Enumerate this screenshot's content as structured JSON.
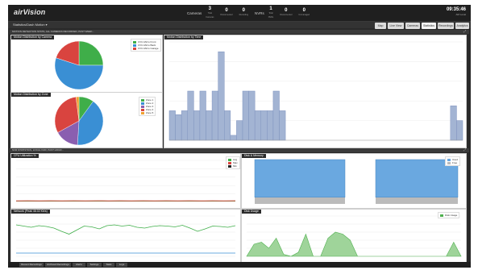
{
  "app": {
    "logo": "airVision"
  },
  "header": {
    "cameras_label": "Cameras",
    "nvrs_label": "NVRs",
    "stats": [
      {
        "value": "3",
        "label": "Total Cameras"
      },
      {
        "value": "0",
        "label": "Disconnected"
      },
      {
        "value": "0",
        "label": "Recording"
      },
      {
        "value": "1",
        "label": "Total NVRs"
      },
      {
        "value": "0",
        "label": "Disconnected"
      },
      {
        "value": "0",
        "label": "Unmanaged"
      }
    ],
    "clock_time": "09:35:46",
    "clock_sub": "AM Local"
  },
  "workspace": {
    "label": "Statistics/Dash Motion ▾"
  },
  "tabs": [
    {
      "label": "Map"
    },
    {
      "label": "Live View"
    },
    {
      "label": "Cameras"
    },
    {
      "label": "Statistics"
    },
    {
      "label": "Recordings"
    },
    {
      "label": "Analytics"
    }
  ],
  "section1": {
    "header": "MOTION DETECTION STATS, ALL CAMERAS RECORDED, PAST WEEK..."
  },
  "section2": {
    "header": "NVR STATISTICS, LOCAL NVR, PAST HOUR..."
  },
  "panels": {
    "motion_camera": "Motion Distribution by Camera",
    "motion_time": "Motion Distribution by Time",
    "motion_zone": "Motion Distribution by Zone",
    "cpu": "CPU Utilization %",
    "disk_memory": "Disk & Memory",
    "network": "Network (Peak 46.02 Kb/s)",
    "disk_usage": "Disk Usage"
  },
  "legends": {
    "camera": [
      {
        "name": "UVC-Micro Front",
        "color": "#3fae49"
      },
      {
        "name": "UVC-Micro Back",
        "color": "#3a8fd4"
      },
      {
        "name": "UVC-Micro Garage",
        "color": "#d9443f"
      }
    ],
    "zone": [
      {
        "name": "Zone 1",
        "color": "#3fae49"
      },
      {
        "name": "Zone 2",
        "color": "#3a8fd4"
      },
      {
        "name": "Zone 3",
        "color": "#8a5fb0"
      },
      {
        "name": "Zone 4",
        "color": "#d9443f"
      },
      {
        "name": "Zone 5",
        "color": "#f0a030"
      }
    ],
    "cpu": [
      {
        "name": "Avg",
        "color": "#3fae49"
      },
      {
        "name": "Max",
        "color": "#d9443f"
      },
      {
        "name": "Min",
        "color": "#222222"
      }
    ],
    "disk": [
      {
        "name": "Used",
        "color": "#6aa8e0"
      },
      {
        "name": "Free",
        "color": "#bbbbbb"
      }
    ],
    "disk_usage": [
      {
        "name": "Disk Usage",
        "color": "#4fb04f"
      }
    ]
  },
  "bottom_tabs": [
    {
      "label": "Recent Recordings"
    },
    {
      "label": "Archived Recordings"
    },
    {
      "label": "Alerts"
    },
    {
      "label": "Settings"
    },
    {
      "label": "Stats"
    },
    {
      "label": "Logs"
    }
  ],
  "chart_data": [
    {
      "type": "pie",
      "categories": [
        "UVC-Micro Front",
        "UVC-Micro Back",
        "UVC-Micro Garage"
      ],
      "values": [
        25,
        55,
        20
      ]
    },
    {
      "type": "pie",
      "categories": [
        "Zone 1",
        "Zone 2",
        "Zone 3",
        "Zone 4",
        "Zone 5"
      ],
      "values": [
        10,
        41,
        16,
        31,
        2
      ]
    },
    {
      "type": "bar",
      "values": [
        3,
        2.6,
        3,
        5,
        3,
        5,
        3,
        5,
        9,
        3,
        0.5,
        2,
        5,
        5,
        3,
        3,
        3,
        5,
        3,
        0,
        0,
        0,
        0,
        0,
        0,
        0,
        0,
        0,
        0,
        0,
        0,
        0,
        0,
        0,
        0,
        0,
        0,
        0,
        0,
        0,
        0,
        0,
        0,
        0,
        0,
        0,
        3.5,
        2
      ]
    },
    {
      "type": "line",
      "series": [
        {
          "name": "Avg",
          "values": [
            3,
            3,
            3,
            3,
            3,
            3,
            3,
            3,
            3,
            3,
            3,
            3,
            3,
            3,
            3,
            3,
            3,
            3,
            3,
            3
          ]
        },
        {
          "name": "Max",
          "values": [
            3.4,
            3.5,
            3.3,
            3.6,
            3.4,
            3.5,
            3.3,
            3.6,
            3.4,
            3.5,
            3.3,
            3.6,
            3.4,
            3.5,
            3.3,
            3.6,
            3.4,
            3.5,
            3.3,
            3.6
          ]
        }
      ],
      "ylim": [
        0,
        100
      ]
    },
    {
      "type": "area",
      "series": [
        {
          "name": "Used",
          "values": [
            85,
            85
          ]
        },
        {
          "name": "Free",
          "values": [
            15,
            15
          ]
        }
      ],
      "ylim": [
        0,
        100
      ]
    },
    {
      "type": "line",
      "series": [
        {
          "name": "In",
          "values": [
            78,
            75,
            72,
            76,
            74,
            70,
            62,
            55,
            65,
            75,
            73,
            68,
            76,
            78,
            75,
            77,
            72,
            70,
            74,
            76,
            75,
            73,
            77,
            70,
            62,
            68,
            75,
            74,
            72,
            76
          ]
        },
        {
          "name": "Out",
          "values": [
            8,
            8,
            8,
            8,
            8,
            8,
            8,
            8,
            8,
            8,
            8,
            8,
            8,
            8,
            8,
            8,
            8,
            8,
            8,
            8,
            8,
            8,
            8,
            8,
            8,
            8,
            8,
            8,
            8,
            8
          ]
        }
      ],
      "ylim": [
        0,
        100
      ]
    },
    {
      "type": "area",
      "series": [
        {
          "name": "Disk Usage",
          "values": [
            0,
            30,
            35,
            20,
            45,
            5,
            0,
            10,
            55,
            0,
            0,
            45,
            60,
            55,
            40,
            0,
            0,
            0,
            0,
            0,
            0,
            0,
            0,
            0,
            0,
            0,
            0,
            0,
            35,
            0
          ]
        }
      ],
      "ylim": [
        0,
        100
      ]
    }
  ]
}
